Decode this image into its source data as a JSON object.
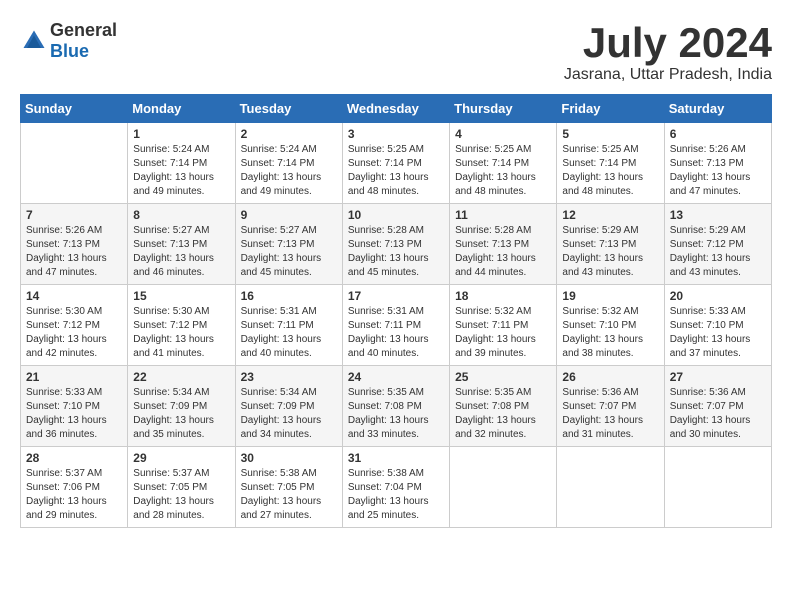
{
  "logo": {
    "general": "General",
    "blue": "Blue"
  },
  "header": {
    "month_year": "July 2024",
    "location": "Jasrana, Uttar Pradesh, India"
  },
  "weekdays": [
    "Sunday",
    "Monday",
    "Tuesday",
    "Wednesday",
    "Thursday",
    "Friday",
    "Saturday"
  ],
  "weeks": [
    [
      {
        "day": "",
        "sunrise": "",
        "sunset": "",
        "daylight": ""
      },
      {
        "day": "1",
        "sunrise": "Sunrise: 5:24 AM",
        "sunset": "Sunset: 7:14 PM",
        "daylight": "Daylight: 13 hours and 49 minutes."
      },
      {
        "day": "2",
        "sunrise": "Sunrise: 5:24 AM",
        "sunset": "Sunset: 7:14 PM",
        "daylight": "Daylight: 13 hours and 49 minutes."
      },
      {
        "day": "3",
        "sunrise": "Sunrise: 5:25 AM",
        "sunset": "Sunset: 7:14 PM",
        "daylight": "Daylight: 13 hours and 48 minutes."
      },
      {
        "day": "4",
        "sunrise": "Sunrise: 5:25 AM",
        "sunset": "Sunset: 7:14 PM",
        "daylight": "Daylight: 13 hours and 48 minutes."
      },
      {
        "day": "5",
        "sunrise": "Sunrise: 5:25 AM",
        "sunset": "Sunset: 7:14 PM",
        "daylight": "Daylight: 13 hours and 48 minutes."
      },
      {
        "day": "6",
        "sunrise": "Sunrise: 5:26 AM",
        "sunset": "Sunset: 7:13 PM",
        "daylight": "Daylight: 13 hours and 47 minutes."
      }
    ],
    [
      {
        "day": "7",
        "sunrise": "Sunrise: 5:26 AM",
        "sunset": "Sunset: 7:13 PM",
        "daylight": "Daylight: 13 hours and 47 minutes."
      },
      {
        "day": "8",
        "sunrise": "Sunrise: 5:27 AM",
        "sunset": "Sunset: 7:13 PM",
        "daylight": "Daylight: 13 hours and 46 minutes."
      },
      {
        "day": "9",
        "sunrise": "Sunrise: 5:27 AM",
        "sunset": "Sunset: 7:13 PM",
        "daylight": "Daylight: 13 hours and 45 minutes."
      },
      {
        "day": "10",
        "sunrise": "Sunrise: 5:28 AM",
        "sunset": "Sunset: 7:13 PM",
        "daylight": "Daylight: 13 hours and 45 minutes."
      },
      {
        "day": "11",
        "sunrise": "Sunrise: 5:28 AM",
        "sunset": "Sunset: 7:13 PM",
        "daylight": "Daylight: 13 hours and 44 minutes."
      },
      {
        "day": "12",
        "sunrise": "Sunrise: 5:29 AM",
        "sunset": "Sunset: 7:13 PM",
        "daylight": "Daylight: 13 hours and 43 minutes."
      },
      {
        "day": "13",
        "sunrise": "Sunrise: 5:29 AM",
        "sunset": "Sunset: 7:12 PM",
        "daylight": "Daylight: 13 hours and 43 minutes."
      }
    ],
    [
      {
        "day": "14",
        "sunrise": "Sunrise: 5:30 AM",
        "sunset": "Sunset: 7:12 PM",
        "daylight": "Daylight: 13 hours and 42 minutes."
      },
      {
        "day": "15",
        "sunrise": "Sunrise: 5:30 AM",
        "sunset": "Sunset: 7:12 PM",
        "daylight": "Daylight: 13 hours and 41 minutes."
      },
      {
        "day": "16",
        "sunrise": "Sunrise: 5:31 AM",
        "sunset": "Sunset: 7:11 PM",
        "daylight": "Daylight: 13 hours and 40 minutes."
      },
      {
        "day": "17",
        "sunrise": "Sunrise: 5:31 AM",
        "sunset": "Sunset: 7:11 PM",
        "daylight": "Daylight: 13 hours and 40 minutes."
      },
      {
        "day": "18",
        "sunrise": "Sunrise: 5:32 AM",
        "sunset": "Sunset: 7:11 PM",
        "daylight": "Daylight: 13 hours and 39 minutes."
      },
      {
        "day": "19",
        "sunrise": "Sunrise: 5:32 AM",
        "sunset": "Sunset: 7:10 PM",
        "daylight": "Daylight: 13 hours and 38 minutes."
      },
      {
        "day": "20",
        "sunrise": "Sunrise: 5:33 AM",
        "sunset": "Sunset: 7:10 PM",
        "daylight": "Daylight: 13 hours and 37 minutes."
      }
    ],
    [
      {
        "day": "21",
        "sunrise": "Sunrise: 5:33 AM",
        "sunset": "Sunset: 7:10 PM",
        "daylight": "Daylight: 13 hours and 36 minutes."
      },
      {
        "day": "22",
        "sunrise": "Sunrise: 5:34 AM",
        "sunset": "Sunset: 7:09 PM",
        "daylight": "Daylight: 13 hours and 35 minutes."
      },
      {
        "day": "23",
        "sunrise": "Sunrise: 5:34 AM",
        "sunset": "Sunset: 7:09 PM",
        "daylight": "Daylight: 13 hours and 34 minutes."
      },
      {
        "day": "24",
        "sunrise": "Sunrise: 5:35 AM",
        "sunset": "Sunset: 7:08 PM",
        "daylight": "Daylight: 13 hours and 33 minutes."
      },
      {
        "day": "25",
        "sunrise": "Sunrise: 5:35 AM",
        "sunset": "Sunset: 7:08 PM",
        "daylight": "Daylight: 13 hours and 32 minutes."
      },
      {
        "day": "26",
        "sunrise": "Sunrise: 5:36 AM",
        "sunset": "Sunset: 7:07 PM",
        "daylight": "Daylight: 13 hours and 31 minutes."
      },
      {
        "day": "27",
        "sunrise": "Sunrise: 5:36 AM",
        "sunset": "Sunset: 7:07 PM",
        "daylight": "Daylight: 13 hours and 30 minutes."
      }
    ],
    [
      {
        "day": "28",
        "sunrise": "Sunrise: 5:37 AM",
        "sunset": "Sunset: 7:06 PM",
        "daylight": "Daylight: 13 hours and 29 minutes."
      },
      {
        "day": "29",
        "sunrise": "Sunrise: 5:37 AM",
        "sunset": "Sunset: 7:05 PM",
        "daylight": "Daylight: 13 hours and 28 minutes."
      },
      {
        "day": "30",
        "sunrise": "Sunrise: 5:38 AM",
        "sunset": "Sunset: 7:05 PM",
        "daylight": "Daylight: 13 hours and 27 minutes."
      },
      {
        "day": "31",
        "sunrise": "Sunrise: 5:38 AM",
        "sunset": "Sunset: 7:04 PM",
        "daylight": "Daylight: 13 hours and 25 minutes."
      },
      {
        "day": "",
        "sunrise": "",
        "sunset": "",
        "daylight": ""
      },
      {
        "day": "",
        "sunrise": "",
        "sunset": "",
        "daylight": ""
      },
      {
        "day": "",
        "sunrise": "",
        "sunset": "",
        "daylight": ""
      }
    ]
  ]
}
